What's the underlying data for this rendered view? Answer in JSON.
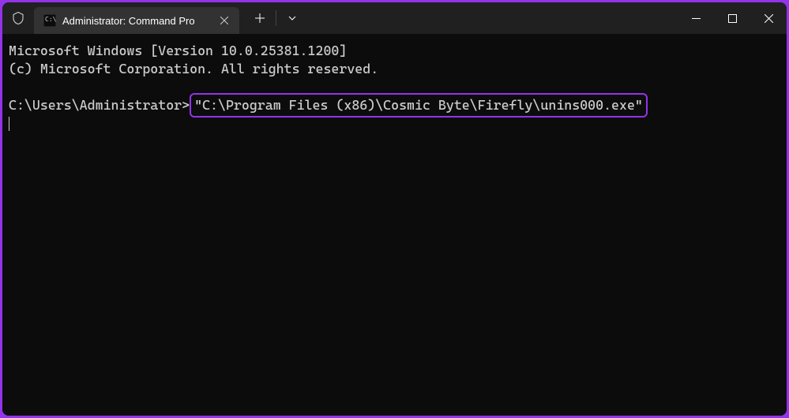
{
  "tab": {
    "title": "Administrator: Command Pro"
  },
  "terminal": {
    "line1": "Microsoft Windows [Version 10.0.25381.1200]",
    "line2": "(c) Microsoft Corporation. All rights reserved.",
    "prompt": "C:\\Users\\Administrator>",
    "command": "\"C:\\Program Files (x86)\\Cosmic Byte\\Firefly\\unins000.exe\""
  }
}
